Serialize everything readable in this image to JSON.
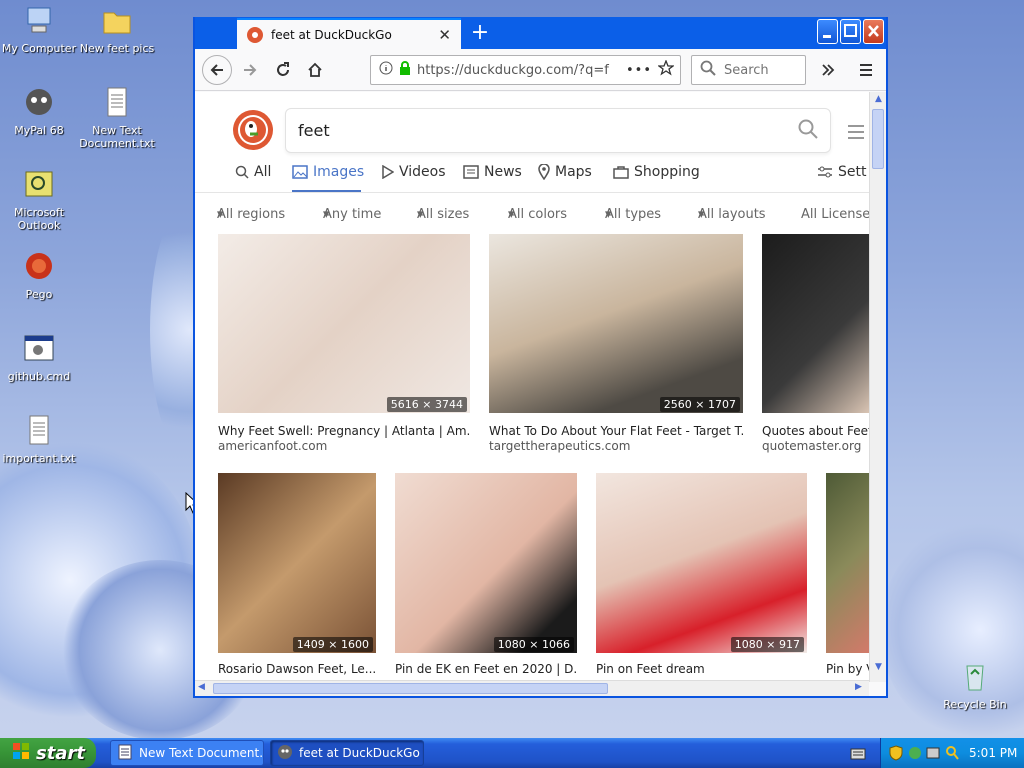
{
  "desktop": {
    "icons": [
      {
        "label": "My Computer",
        "icon": "computer-icon"
      },
      {
        "label": "New feet pics",
        "icon": "folder-icon"
      },
      {
        "label": "MyPal 68",
        "icon": "browser-shortcut-icon"
      },
      {
        "label": "New Text Document.txt",
        "icon": "text-file-icon"
      },
      {
        "label": "Microsoft Outlook",
        "icon": "outlook-icon"
      },
      {
        "label": "Pego",
        "icon": "app-shortcut-icon"
      },
      {
        "label": "github.cmd",
        "icon": "cmd-file-icon"
      },
      {
        "label": "important.txt",
        "icon": "text-file-icon"
      },
      {
        "label": "Recycle Bin",
        "icon": "recycle-bin-icon"
      }
    ]
  },
  "browser": {
    "tab_title": "feet at DuckDuckGo",
    "url": "https://duckduckgo.com/?q=f",
    "search_placeholder": "Search",
    "page": {
      "query": "feet",
      "nav": [
        "All",
        "Images",
        "Videos",
        "News",
        "Maps",
        "Shopping",
        "Sett"
      ],
      "active_nav": "Images",
      "filters": [
        "All regions",
        "Any time",
        "All sizes",
        "All colors",
        "All types",
        "All layouts",
        "All License"
      ],
      "results": [
        {
          "title": "Why Feet Swell: Pregnancy | Atlanta | Am...",
          "source": "americanfoot.com",
          "dims": "5616 × 3744",
          "color": "#e9dcd3"
        },
        {
          "title": "What To Do About Your Flat Feet - Target T...",
          "source": "targettherapeutics.com",
          "dims": "2560 × 1707",
          "color": "#c7b8a6"
        },
        {
          "title": "Quotes about Feet",
          "source": "quotemaster.org",
          "dims": "",
          "color": "#2a2a2a"
        },
        {
          "title": "Rosario Dawson Feet, Le...",
          "source": "",
          "dims": "1409 × 1600",
          "color": "#8c6b4d"
        },
        {
          "title": "Pin de EK en Feet en 2020 | D...",
          "source": "",
          "dims": "1080 × 1066",
          "color": "#e6c4b5"
        },
        {
          "title": "Pin on Feet dream",
          "source": "",
          "dims": "1080 × 917",
          "color": "#e8d1c7"
        },
        {
          "title": "Pin by V",
          "source": "",
          "dims": "",
          "color": "#6b7a4a"
        }
      ]
    }
  },
  "taskbar": {
    "start_label": "start",
    "tasks": [
      "New Text Document....",
      "feet at DuckDuckGo -..."
    ],
    "clock": "5:01 PM"
  }
}
